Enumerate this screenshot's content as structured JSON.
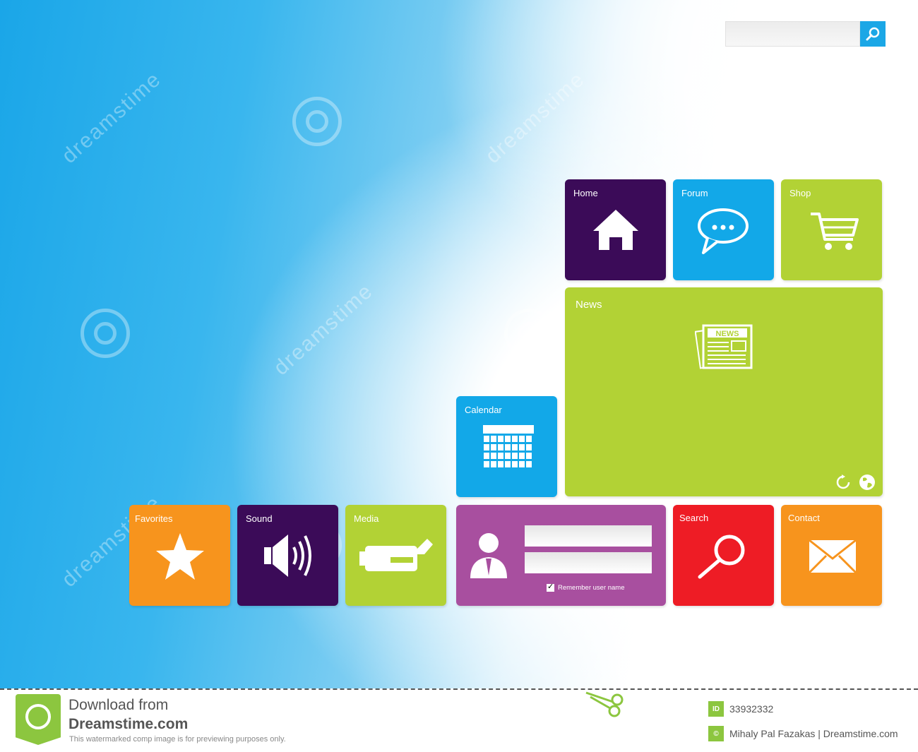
{
  "search": {
    "placeholder": ""
  },
  "tiles": {
    "home": "Home",
    "forum": "Forum",
    "shop": "Shop",
    "news": "News",
    "news_icon_text": "NEWS",
    "calendar": "Calendar",
    "favorites": "Favorites",
    "sound": "Sound",
    "media": "Media",
    "remember": "Remember user name",
    "search": "Search",
    "contact": "Contact"
  },
  "colors": {
    "purple": "#3b0b58",
    "blue": "#12a8e8",
    "green": "#b2d235",
    "orange": "#f7941d",
    "magenta": "#a84f9f",
    "red": "#ee1c25"
  },
  "watermark": {
    "text": "dreamstime",
    "symbol": "©"
  },
  "footer": {
    "download": "Download from",
    "site": "Dreamstime.com",
    "note": "This watermarked comp image is for previewing purposes only.",
    "id_badge": "ID",
    "id": "33932332",
    "copyright_badge": "©",
    "author": "Mihaly Pal Fazakas | Dreamstime.com"
  }
}
